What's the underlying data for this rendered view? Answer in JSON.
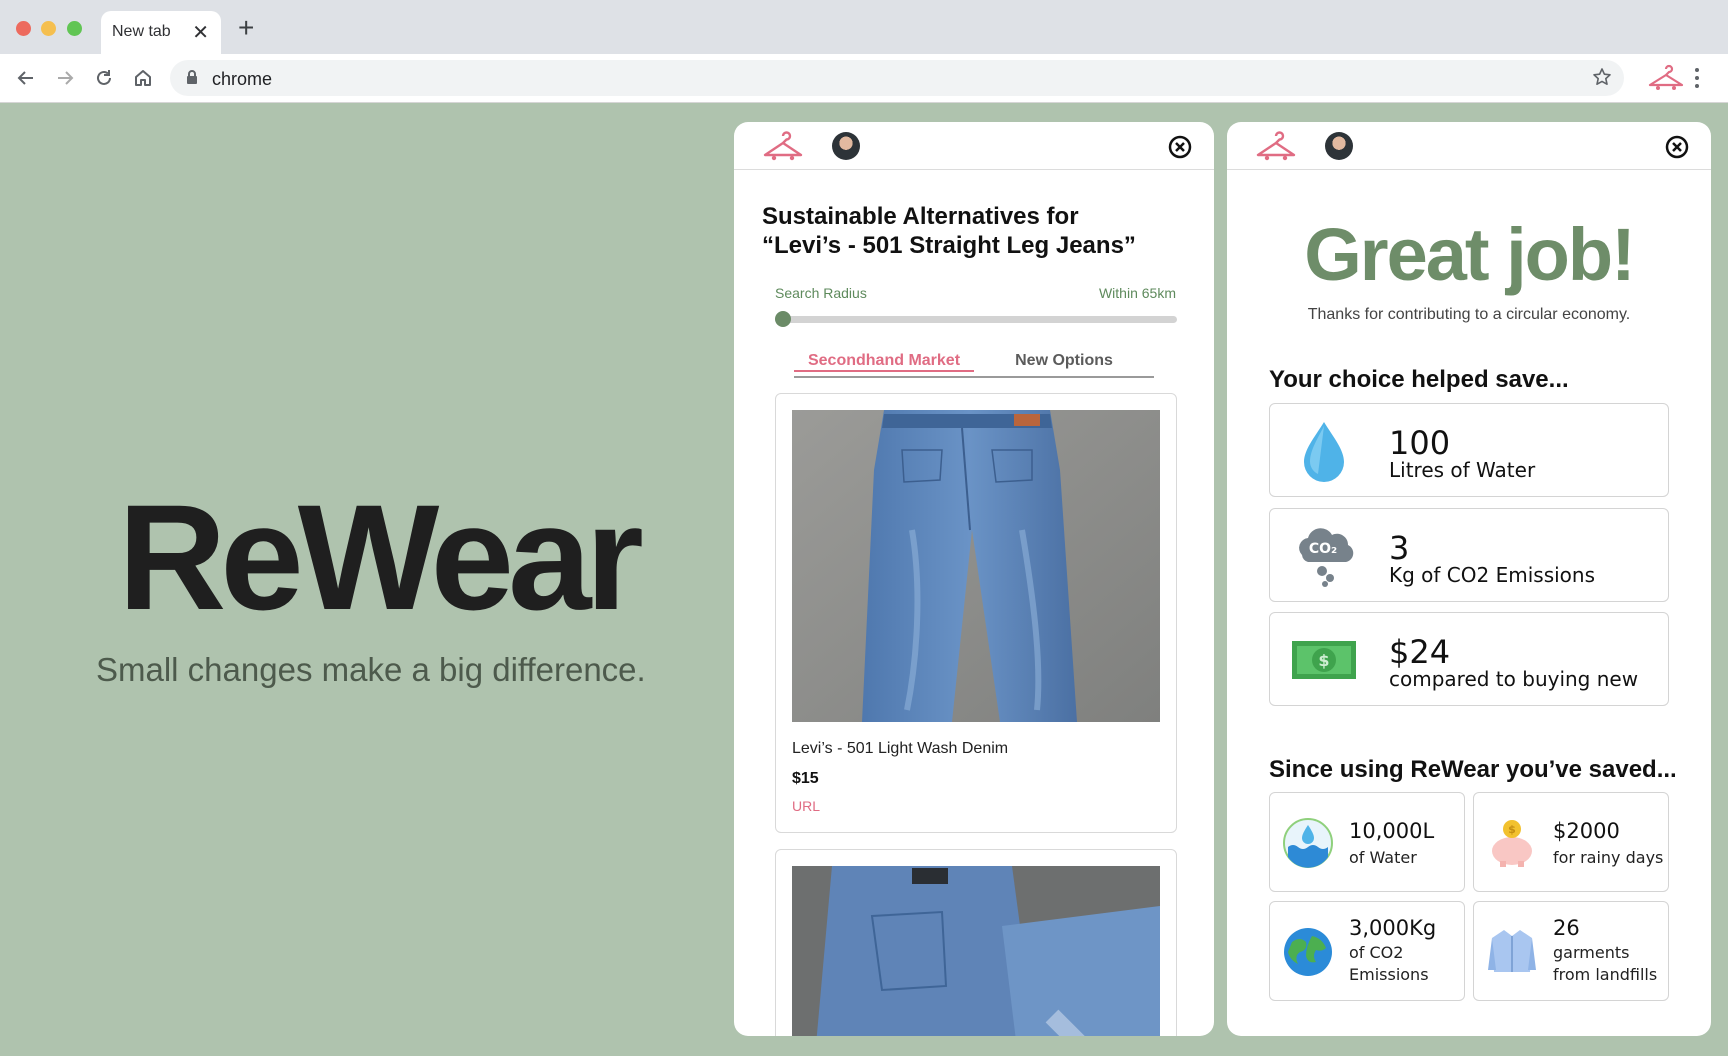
{
  "browser": {
    "tab_title": "New tab",
    "address": "chrome"
  },
  "hero": {
    "brand": "ReWear",
    "tagline": "Small changes make a big difference."
  },
  "alternatives_panel": {
    "title_line1": "Sustainable Alternatives for",
    "title_line2": "“Levi’s - 501 Straight Leg Jeans”",
    "search_radius_label": "Search Radius",
    "search_radius_value": "Within 65km",
    "tabs": [
      "Secondhand Market",
      "New Options"
    ],
    "active_tab": "Secondhand Market",
    "listings": [
      {
        "name": "Levi’s - 501 Light Wash Denim",
        "price": "$15",
        "link": "URL"
      }
    ]
  },
  "impact_panel": {
    "headline": "Great job!",
    "subheadline": "Thanks for contributing to a circular economy.",
    "choice_title": "Your choice helped save...",
    "choice_items": [
      {
        "value": "100",
        "label": "Litres of Water",
        "icon": "water-drop-icon"
      },
      {
        "value": "3",
        "label": "Kg of CO2 Emissions",
        "icon": "co2-cloud-icon"
      },
      {
        "value": "$24",
        "label": "compared to buying new",
        "icon": "money-icon"
      }
    ],
    "totals_title": "Since using ReWear you’ve saved...",
    "totals": [
      {
        "value": "10,000L",
        "label": "of Water",
        "icon": "water-wave-icon"
      },
      {
        "value": "$2000",
        "label": "for rainy days",
        "icon": "piggy-bank-icon"
      },
      {
        "value": "3,000Kg",
        "label": "of CO2 Emissions",
        "icon": "earth-icon"
      },
      {
        "value": "26",
        "label": "garments from landfills",
        "icon": "shirt-icon"
      }
    ]
  },
  "colors": {
    "background": "#afc3ae",
    "accent_pink": "#e06c83",
    "accent_green": "#6e8d69"
  }
}
